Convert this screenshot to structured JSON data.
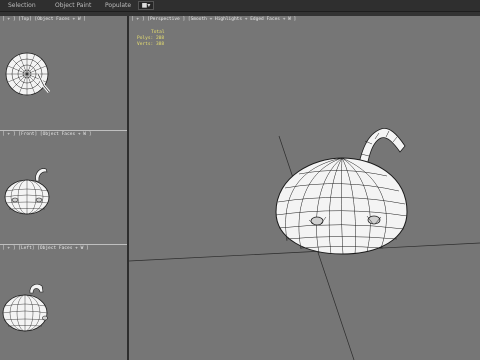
{
  "menu": {
    "items": [
      "Selection",
      "Object Paint",
      "Populate"
    ],
    "dropdown_icon": "display-icon"
  },
  "viewports": {
    "top": {
      "label": "[ + ] [Top] [Object Faces + W ]"
    },
    "left1": {
      "label": "[ + ] [Front] [Object Faces + W ]"
    },
    "left2": {
      "label": "[ + ] [Left] [Object Faces + W ]"
    },
    "perspective": {
      "label": "[ + ] [Perspective ] [Smooth + Highlights + Edged Faces + W ]",
      "stats": {
        "title": "Total",
        "polys_label": "Polys: 208",
        "verts_label": "Verts: 388"
      }
    }
  },
  "colors": {
    "viewport_bg": "#767676",
    "grid_line": "#2b2b2b",
    "mesh_fill": "#f4f4f4",
    "mesh_wire": "#1a1a1a",
    "stats_text": "#e8e070"
  }
}
